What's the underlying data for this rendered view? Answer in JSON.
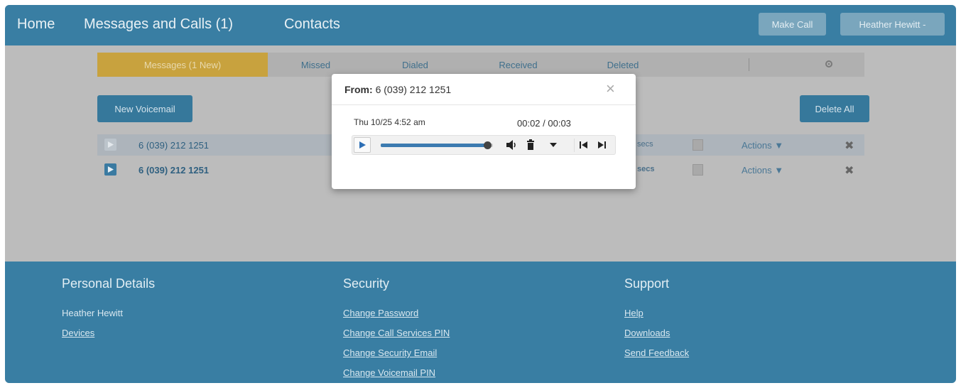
{
  "nav": {
    "home": "Home",
    "messages": "Messages and Calls (1)",
    "contacts": "Contacts",
    "make_call": "Make Call",
    "user_menu": "Heather Hewitt -"
  },
  "tabs": [
    {
      "label": "Messages (1 New)"
    },
    {
      "label": "Missed"
    },
    {
      "label": "Dialed"
    },
    {
      "label": "Received"
    },
    {
      "label": "Deleted"
    }
  ],
  "toolbar": {
    "new_voicemail": "New Voicemail",
    "delete_all": "Delete All"
  },
  "rows": [
    {
      "number": "6 (039) 212 1251",
      "secs": "secs",
      "actions": "Actions ▼",
      "delete": "✖"
    },
    {
      "number": "6 (039) 212 1251",
      "secs": "secs",
      "actions": "Actions ▼",
      "delete": "✖"
    }
  ],
  "modal": {
    "from_label": "From:",
    "from_value": "6 (039) 212 1251",
    "close": "×",
    "date": "Thu 10/25 4:52 am",
    "time": "00:02 / 00:03",
    "progress": 0.95
  },
  "footer": {
    "personal": {
      "heading": "Personal Details",
      "name": "Heather Hewitt",
      "devices": "Devices"
    },
    "security": {
      "heading": "Security",
      "links": [
        "Change Password",
        "Change Call Services PIN",
        "Change Security Email",
        "Change Voicemail PIN"
      ]
    },
    "support": {
      "heading": "Support",
      "links": [
        "Help",
        "Downloads",
        "Send Feedback"
      ]
    }
  },
  "colors": {
    "brand": "#397ea3",
    "active_tab": "#c8a23e",
    "button": "#36789b",
    "progress": "#3c7bb0"
  },
  "icons": {
    "settings": "gear-icon",
    "play": "play-icon",
    "volume": "volume-icon",
    "trash": "trash-icon",
    "menu": "caret-down-icon",
    "prev": "skip-back-icon",
    "next": "skip-forward-icon"
  }
}
